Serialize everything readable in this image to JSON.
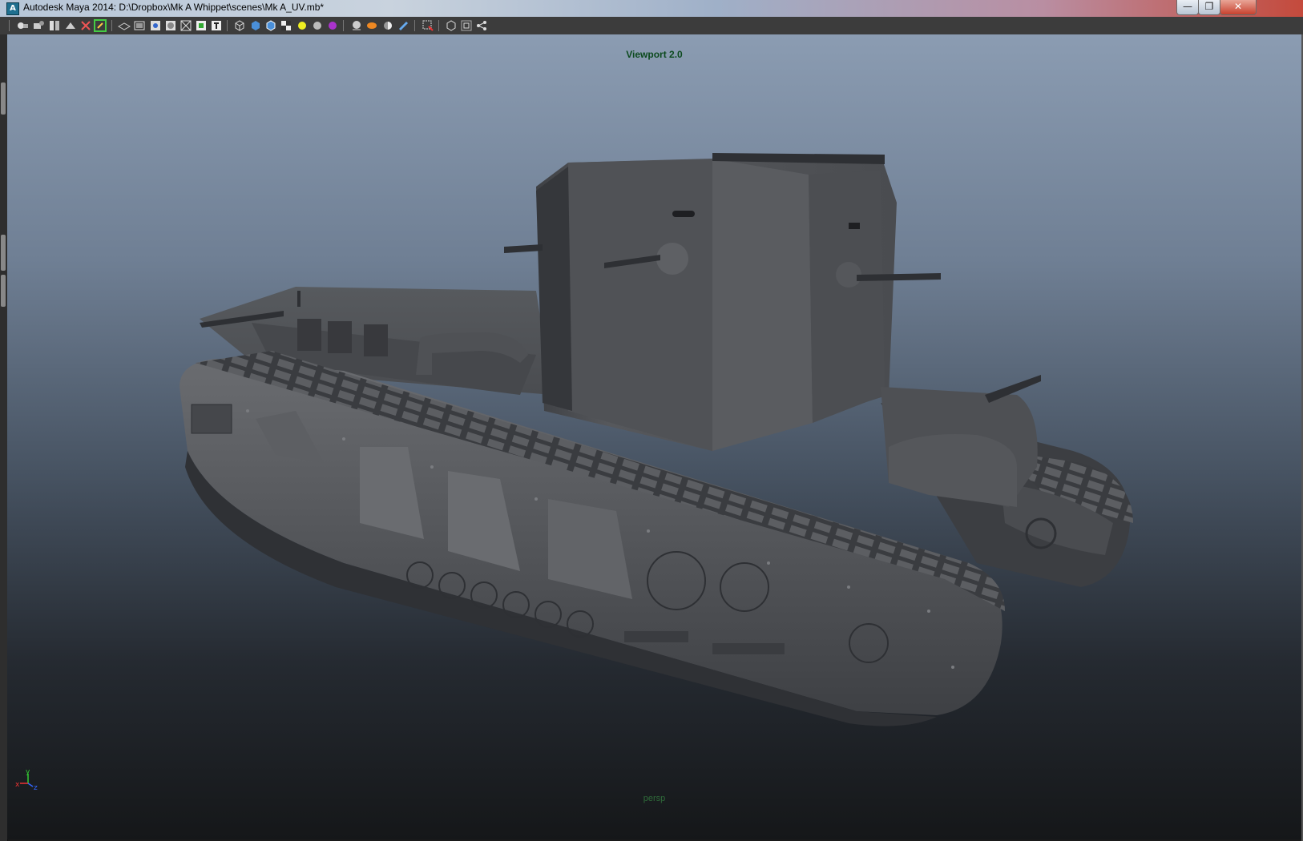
{
  "window": {
    "title": "Autodesk Maya 2014: D:\\Dropbox\\Mk A Whippet\\scenes\\Mk A_UV.mb*",
    "app_icon_glyph": "A",
    "minimize_glyph": "—",
    "restore_glyph": "❐",
    "close_glyph": "✕"
  },
  "toolbar": {
    "icons": [
      "select-camera-icon",
      "camera-attributes-icon",
      "bookmarks-icon",
      "image-plane-icon",
      "two-d-pan-icon",
      "grease-pencil-icon",
      "grid-icon",
      "film-gate-icon",
      "resolution-gate-icon",
      "gate-mask-icon",
      "field-chart-icon",
      "safe-action-icon",
      "safe-title-icon",
      "wireframe-icon",
      "smooth-shade-icon",
      "wireframe-on-shaded-icon",
      "textured-icon",
      "use-default-lighting-icon",
      "shadows-icon",
      "screen-space-ao-icon",
      "motion-blur-icon",
      "multisample-aa-icon",
      "depth-of-field-icon",
      "isolate-select-icon",
      "xray-icon",
      "xray-joints-icon",
      "xray-components-icon"
    ]
  },
  "viewport": {
    "renderer_label": "Viewport 2.0",
    "camera_label": "persp",
    "axis": {
      "y": "y",
      "x": "x",
      "z": "z"
    }
  },
  "colors": {
    "viewport_top": "#8b9cb2",
    "viewport_bottom": "#151719",
    "renderer_label": "#0c4a1e",
    "model_gray": "#5a5c60"
  }
}
